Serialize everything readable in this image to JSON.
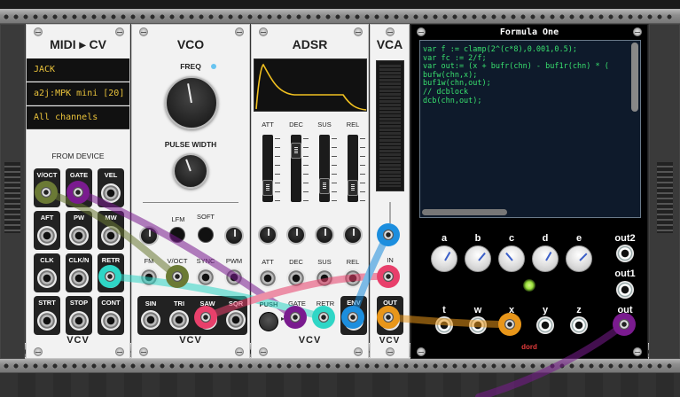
{
  "midi_cv": {
    "title": "MIDI ▸ CV",
    "driver": "JACK",
    "device": "a2j:MPK mini [20] (",
    "channel": "All channels",
    "from_device": "FROM DEVICE",
    "outputs": [
      "V/OCT",
      "GATE",
      "VEL",
      "AFT",
      "PW",
      "MW",
      "CLK",
      "CLK/N",
      "RETR",
      "STRT",
      "STOP",
      "CONT"
    ],
    "logo": "VCV"
  },
  "vco": {
    "title": "VCO",
    "freq_label": "FREQ",
    "pw_label": "PULSE WIDTH",
    "lfm_label": "LFM",
    "soft_label": "SOFT",
    "inputs": [
      "FM",
      "V/OCT",
      "SYNC",
      "PWM"
    ],
    "outputs": [
      "SIN",
      "TRI",
      "SAW",
      "SQR"
    ],
    "logo": "VCV"
  },
  "adsr": {
    "title": "ADSR",
    "slider_labels": [
      "ATT",
      "DEC",
      "SUS",
      "REL"
    ],
    "slider_levels": [
      0.12,
      0.85,
      0.15,
      0.12
    ],
    "cv_labels": [
      "ATT",
      "DEC",
      "SUS",
      "REL"
    ],
    "push_label": "PUSH",
    "gate_label": "GATE",
    "retr_label": "RETR",
    "env_label": "ENV",
    "logo": "VCV"
  },
  "vca": {
    "title": "VCA",
    "in_label": "IN",
    "out_label": "OUT",
    "logo": "VCV"
  },
  "formula": {
    "title": "Formula One",
    "code": [
      "var f := clamp(2^(c*8),0.001,0.5);",
      "var fc := 2/f;",
      "var out:= (x + bufr(chn) - buf1r(chn) * (",
      "bufw(chn,x);",
      "buf1w(chn,out);",
      "// dcblock",
      "dcb(chn,out);"
    ],
    "knob_labels": [
      "a",
      "b",
      "c",
      "d",
      "e"
    ],
    "out2_label": "out2",
    "out1_label": "out1",
    "input_labels": [
      "t",
      "w",
      "x",
      "y",
      "z"
    ],
    "out_label": "out",
    "logo": "dord"
  },
  "colors": {
    "code_green": "#39e06e",
    "code_bg": "#0e1a2b",
    "midi_text": "#e9c23b",
    "cable_purple": "#7a1b8f",
    "cable_teal": "#2fd6c6",
    "cable_pink": "#e8406b",
    "cable_blue": "#1c8ede",
    "cable_orange": "#e8961a",
    "cable_olive": "#6b7a35",
    "led_green": "#9be23c"
  }
}
